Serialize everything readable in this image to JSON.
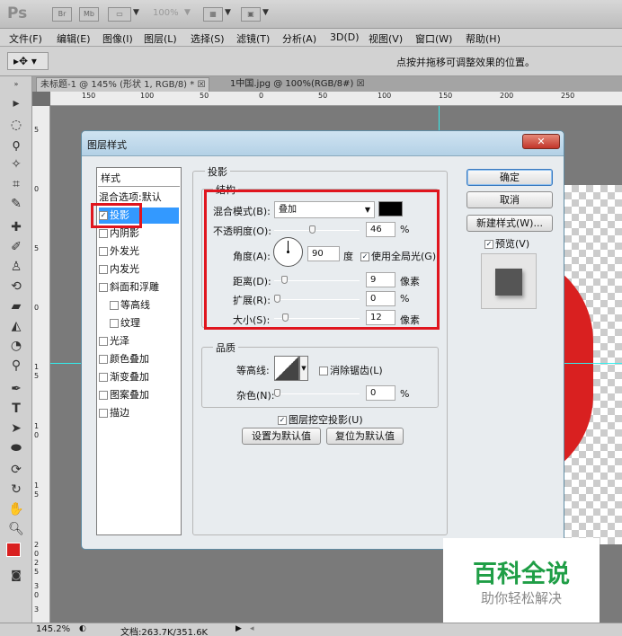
{
  "app": {
    "logo": "Ps",
    "logo_letters": [
      "Br",
      "Mb"
    ],
    "zoom_dropdown": "100%",
    "menu": [
      "文件(F)",
      "编辑(E)",
      "图像(I)",
      "图层(L)",
      "选择(S)",
      "滤镜(T)",
      "分析(A)",
      "3D(D)",
      "视图(V)",
      "窗口(W)",
      "帮助(H)"
    ],
    "option_hint": "点按并拖移可调整效果的位置。",
    "tabs": [
      "未标题-1 @ 145% (形状 1, RGB/8) * ☒",
      "1中国.jpg @ 100%(RGB/8#) ☒"
    ],
    "ruler_top": [
      "150",
      "100",
      "50",
      "0",
      "50",
      "100",
      "150",
      "200",
      "250"
    ],
    "ruler_left": [
      "5",
      "0",
      "5",
      "0",
      "1",
      "5",
      "1",
      "0",
      "1",
      "5",
      "2",
      "0",
      "2",
      "5",
      "3",
      "0",
      "3"
    ],
    "status_zoom": "145.2%",
    "status_doc": "文档:263.7K/351.6K"
  },
  "dialog": {
    "title": "图层样式",
    "close": "✕",
    "style_list_header": "样式",
    "style_list": [
      {
        "label": "混合选项:默认",
        "checkbox": false
      },
      {
        "label": "投影",
        "checkbox": true,
        "checked": true,
        "active": true
      },
      {
        "label": "内阴影",
        "checkbox": true,
        "checked": false
      },
      {
        "label": "外发光",
        "checkbox": true,
        "checked": false
      },
      {
        "label": "内发光",
        "checkbox": true,
        "checked": false
      },
      {
        "label": "斜面和浮雕",
        "checkbox": true,
        "checked": false
      },
      {
        "label": "等高线",
        "checkbox": true,
        "checked": false,
        "indent": true
      },
      {
        "label": "纹理",
        "checkbox": true,
        "checked": false,
        "indent": true
      },
      {
        "label": "光泽",
        "checkbox": true,
        "checked": false
      },
      {
        "label": "颜色叠加",
        "checkbox": true,
        "checked": false
      },
      {
        "label": "渐变叠加",
        "checkbox": true,
        "checked": false
      },
      {
        "label": "图案叠加",
        "checkbox": true,
        "checked": false
      },
      {
        "label": "描边",
        "checkbox": true,
        "checked": false
      }
    ],
    "section_title": "投影",
    "structure_title": "结构",
    "blend_label": "混合模式(B):",
    "blend_value": "叠加",
    "blend_color": "#000000",
    "opacity_label": "不透明度(O):",
    "opacity_value": "46",
    "opacity_unit": "%",
    "angle_label": "角度(A):",
    "angle_value": "90",
    "angle_unit": "度",
    "global_light_label": "使用全局光(G)",
    "global_light_checked": true,
    "distance_label": "距离(D):",
    "distance_value": "9",
    "distance_unit": "像素",
    "spread_label": "扩展(R):",
    "spread_value": "0",
    "spread_unit": "%",
    "size_label": "大小(S):",
    "size_value": "12",
    "size_unit": "像素",
    "quality_title": "品质",
    "contour_label": "等高线:",
    "antialias_label": "消除锯齿(L)",
    "noise_label": "杂色(N):",
    "noise_value": "0",
    "noise_unit": "%",
    "knockout_label": "图层挖空投影(U)",
    "knockout_checked": true,
    "make_default": "设置为默认值",
    "reset_default": "复位为默认值",
    "ok": "确定",
    "cancel": "取消",
    "new_style": "新建样式(W)...",
    "preview_label": "预览(V)",
    "preview_checked": true
  },
  "watermark": {
    "title": "百科全说",
    "subtitle": "助你轻松解决"
  },
  "colors": {
    "highlight": "#e0151e",
    "shape_red": "#d92020",
    "watermark_green": "#1f9e46"
  }
}
